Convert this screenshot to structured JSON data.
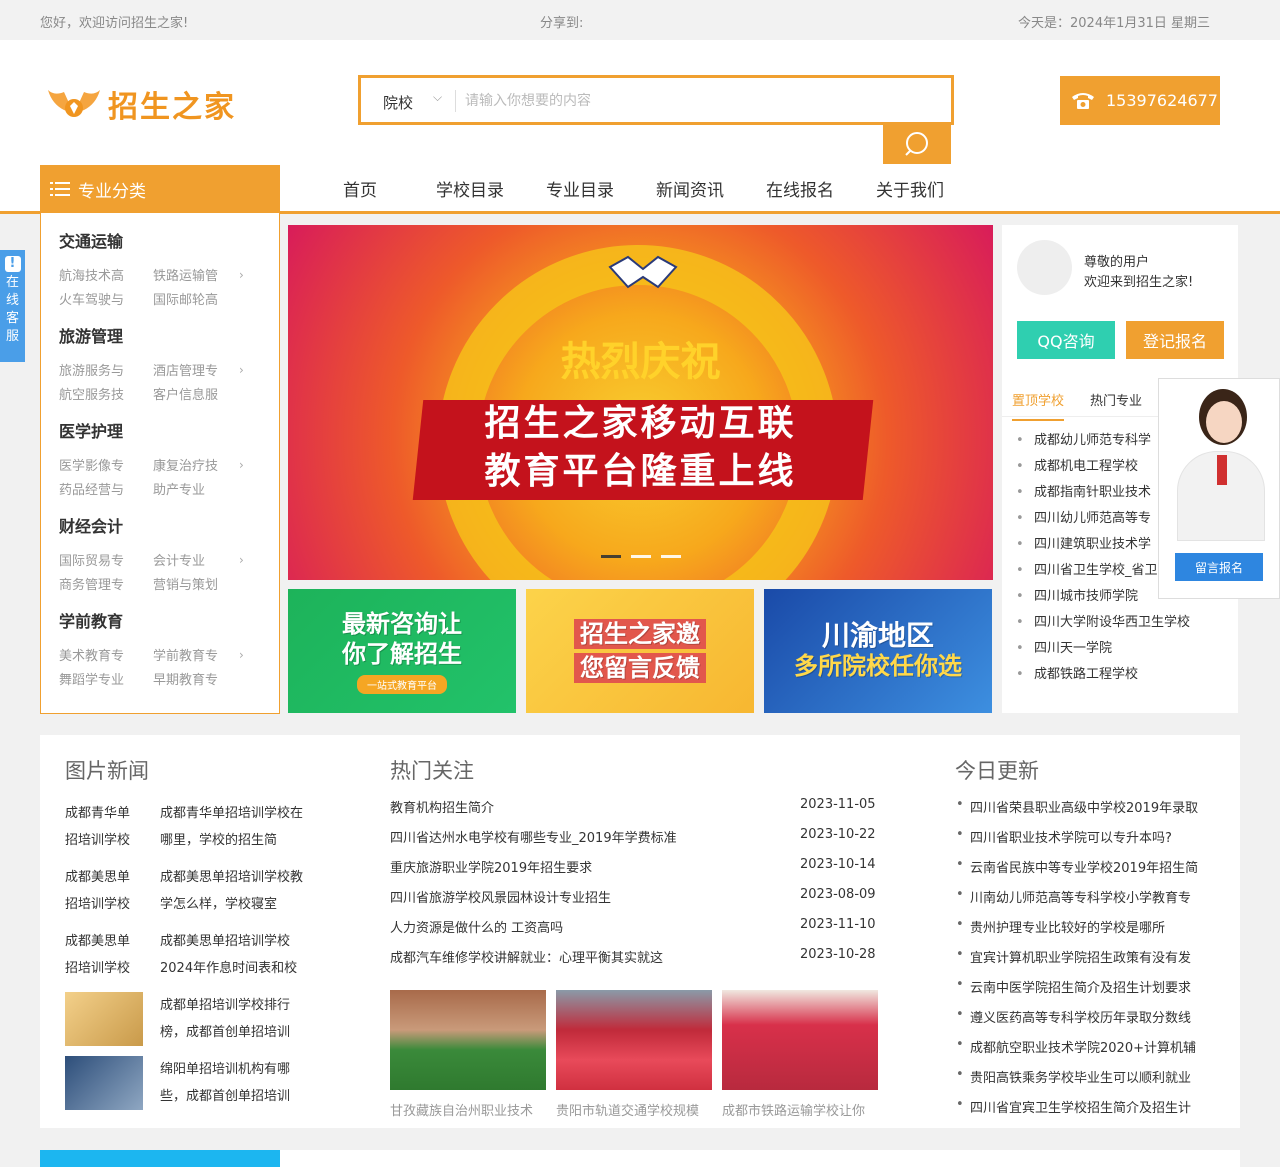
{
  "topbar": {
    "welcome": "您好，欢迎访问招生之家!",
    "share": "分享到:",
    "date": "今天是：2024年1月31日 星期三"
  },
  "logo": {
    "text": "招生之家"
  },
  "search": {
    "category": "院校",
    "placeholder": "请输入你想要的内容"
  },
  "phone": {
    "number": "15397624677"
  },
  "category_button": {
    "label": "专业分类"
  },
  "nav": {
    "items": [
      "首页",
      "学校目录",
      "专业目录",
      "新闻资讯",
      "在线报名",
      "关于我们"
    ]
  },
  "sidebar": {
    "groups": [
      {
        "title": "交通运输",
        "subs": [
          "航海技术高",
          "铁路运输管",
          "火车驾驶与",
          "国际邮轮高"
        ]
      },
      {
        "title": "旅游管理",
        "subs": [
          "旅游服务与",
          "酒店管理专",
          "航空服务技",
          "客户信息服"
        ]
      },
      {
        "title": "医学护理",
        "subs": [
          "医学影像专",
          "康复治疗技",
          "药品经营与",
          "助产专业"
        ]
      },
      {
        "title": "财经会计",
        "subs": [
          "国际贸易专",
          "会计专业",
          "商务管理专",
          "营销与策划"
        ]
      },
      {
        "title": "学前教育",
        "subs": [
          "美术教育专",
          "学前教育专",
          "舞蹈学专业",
          "早期教育专"
        ]
      }
    ]
  },
  "kefu": {
    "label": "在线客服"
  },
  "banner": {
    "headline": "热烈庆祝",
    "line1": "招生之家移动互联",
    "line2": "教育平台隆重上线"
  },
  "promos": [
    {
      "line1": "最新咨询让",
      "line2": "你了解招生",
      "tag": "一站式教育平台"
    },
    {
      "line1": "招生之家邀",
      "line2": "您留言反馈"
    },
    {
      "line1": "川渝地区",
      "line2": "多所院校任你选"
    }
  ],
  "user": {
    "greeting1": "尊敬的用户",
    "greeting2": "欢迎来到招生之家!",
    "qq_button": "QQ咨询",
    "register_button": "登记报名"
  },
  "tabs": {
    "top": "置顶学校",
    "hot": "热门专业"
  },
  "schools": [
    "成都幼儿师范专科学",
    "成都机电工程学校",
    "成都指南针职业技术",
    "四川幼儿师范高等专",
    "四川建筑职业技术学",
    "四川省卫生学校_省卫",
    "四川城市技师学院",
    "四川大学附设华西卫生学校",
    "四川天一学院",
    "成都铁路工程学校"
  ],
  "agent": {
    "button": "留言报名"
  },
  "photo_news": {
    "title": "图片新闻",
    "items": [
      {
        "a1": "成都青华单",
        "a2": "招培训学校",
        "b1": "成都青华单招培训学校在",
        "b2": "哪里，学校的招生简"
      },
      {
        "a1": "成都美思单",
        "a2": "招培训学校",
        "b1": "成都美思单招培训学校教",
        "b2": "学怎么样，学校寝室"
      },
      {
        "a1": "成都美思单",
        "a2": "招培训学校",
        "b1": "成都美思单招培训学校",
        "b2": "2024年作息时间表和校"
      },
      {
        "b1": "成都单招培训学校排行",
        "b2": "榜，成都首创单招培训"
      },
      {
        "b1": "绵阳单招培训机构有哪",
        "b2": "些，成都首创单招培训"
      }
    ]
  },
  "hot_news": {
    "title": "热门关注",
    "items": [
      {
        "text": "教育机构招生简介",
        "date": "2023-11-05"
      },
      {
        "text": "四川省达州水电学校有哪些专业_2019年学费标准",
        "date": "2023-10-22"
      },
      {
        "text": "重庆旅游职业学院2019年招生要求",
        "date": "2023-10-14"
      },
      {
        "text": "四川省旅游学校风景园林设计专业招生",
        "date": "2023-08-09"
      },
      {
        "text": "人力资源是做什么的 工资高吗",
        "date": "2023-11-10"
      },
      {
        "text": "成都汽车维修学校讲解就业：心理平衡其实就这",
        "date": "2023-10-28"
      }
    ],
    "captions": [
      "甘孜藏族自治州职业技术",
      "贵阳市轨道交通学校规模",
      "成都市铁路运输学校让你"
    ]
  },
  "today": {
    "title": "今日更新",
    "items": [
      "四川省荣县职业高级中学校2019年录取",
      "四川省职业技术学院可以专升本吗?",
      "云南省民族中等专业学校2019年招生简",
      "川南幼儿师范高等专科学校小学教育专",
      "贵州护理专业比较好的学校是哪所",
      "宜宾计算机职业学院招生政策有没有发",
      "云南中医学院招生简介及招生计划要求",
      "遵义医药高等专科学校历年录取分数线",
      "成都航空职业技术学院2020+计算机辅",
      "贵阳高铁乘务学校毕业生可以顺利就业",
      "四川省宜宾卫生学校招生简介及招生计"
    ]
  },
  "colors": {
    "accent": "#f0a030",
    "teal": "#2fcfb0",
    "blue": "#2e86e0"
  }
}
